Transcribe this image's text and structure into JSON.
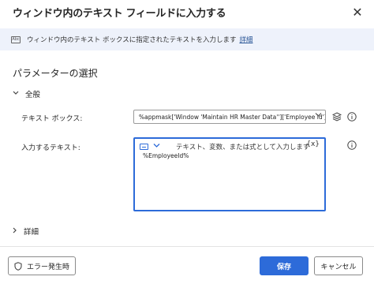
{
  "dialog": {
    "title": "ウィンドウ内のテキスト フィールドに入力する",
    "close_glyph": "✕"
  },
  "info": {
    "icon_text": "Abc",
    "text": "ウィンドウ内のテキスト ボックスに指定されたテキストを入力します",
    "link": "詳細"
  },
  "params": {
    "section_title": "パラメーターの選択",
    "group_general": "全般",
    "textbox_label": "テキスト ボックス:",
    "textbox_value": "%appmask['Window 'Maintain HR Master Data'']['Employee id']%",
    "input_label": "入力するテキスト:",
    "input_placeholder": "テキスト、変数、または式として入力します",
    "input_var_button": "{x}",
    "input_value": "%EmployeeId%",
    "details": "詳細"
  },
  "footer": {
    "error_button": "エラー発生時",
    "save_button": "保存",
    "cancel_button": "キャンセル"
  },
  "colors": {
    "accent": "#2d6bd9",
    "info_bar_bg": "#eef2fb"
  }
}
